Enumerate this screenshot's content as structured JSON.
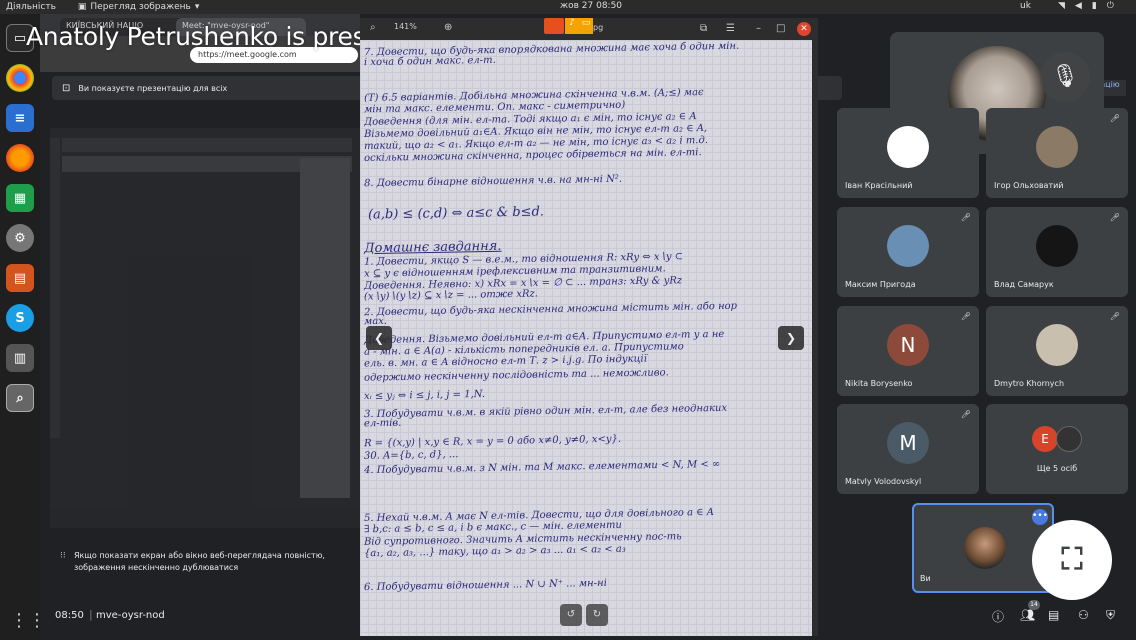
{
  "topbar": {
    "activities": "Діяльність",
    "app_name": "Перегляд зображень",
    "clock": "жов 27  08:50",
    "keyboard": "uk"
  },
  "browser": {
    "tab1": "КИЇВСЬКИЙ НАЦІО",
    "tab2": "Meet: \"mve-oysr-nod\"",
    "url": "https://meet.google.com"
  },
  "presenting_label": "Anatoly Petrushenko is presenting",
  "banner": {
    "text": "Ви показуєте презентацію для всіх",
    "right_text": "зацію"
  },
  "share_notice": "Якщо показати екран або вікно веб-переглядача повністю, зображення нескінченно дублюватися",
  "viewer": {
    "zoom": "141%",
    "file_suffix": "pg",
    "handwriting": [
      "7. Довести, що будь-яка впорядкована множина має хоча б один мін.",
      "і хоча б один макс. ел-т.",
      "(Т) 6.5 варіантів. Добільна множина скінченна ч.в.м. (A;≤) має",
      "мін та макс. елементи. Оп. макс - симетрично)",
      "Доведення (для мін. ел-та. Тоді якщо a₁ є мін, то існує a₂ ∈ A",
      "Візьмемо довільний a₁∈A. Якщо він не мін, то існує ел-т a₂ ∈ A,",
      "такий, що a₂ < a₁. Якщо ел-т a₂ — не мін, то існує a₃ < a₂ і т.д.",
      "оскільки множина скінченна, процес обірветься на мін. ел-ті.",
      "8. Довести бінарне відношення ч.в. на мн-ні N².",
      "(a,b) ≤ (c,d) ⇔ a≤c & b≤d.",
      "Домашнє завдання.",
      "1. Довести, якщо S — в.е.м., то відношення R: xRy ⇔ x∖y ⊂",
      "x ⊆ y є відношенням ірефлексивним та транзитивним.",
      "Доведення. Неявно: x) xRx = x∖x = ∅ ⊂ ... транз: xRy & yRz",
      "(x∖y)∖(y∖z) ⊆ x∖z = ... отже xRz.",
      "2. Довести, що будь-яка нескінченна множина містить мін. або нор",
      "мах.",
      "Доведення. Візьмемо довільний ел-т a∈A. Припустимо ел-т у а не",
      "а - мін. a ∈ A(a) - кількість попередників ел. а. Припустимо",
      "ель. в. мн. a ∈ A відносно ел-т Т. z > i.j.g. По індукції",
      "одержимо нескінченну послідовність та ... неможливо.",
      "xᵢ ≤ yⱼ ⇔ i ≤ j,  i, j = 1,N.",
      "3. Побудувати ч.в.м. в якій рівно один мін. ел-т, але без неоднаких",
      "ел-тів.",
      "R = {(x,y) | x,y ∈ R, x = y = 0 або x≠0, y≠0, x<y}.",
      "30. A={b, c, d}, ...",
      "4. Побудувати ч.в.м. з N мін. та M макс. елементами < N, M < ∞",
      "5. Нехай ч.в.м. A має N ел-тів. Довести, що для довільного a ∈ A",
      "∃ b,c: a ≤ b, c ≤ a, і b є макс., c — мін. елементи",
      "Від супротивного. Значить A містить нескінченну пос-ть",
      "{a₁, a₂, a₃, ...} таку, що a₁ > a₂ > a₃ ...   a₁ < a₂ < a₃",
      "6. Побудувати відношення ... N ∪ N⁺ ... мн-ні"
    ]
  },
  "participants": [
    {
      "name": "Іван Красільний",
      "initial": "",
      "color": "#ffffff",
      "muted": false
    },
    {
      "name": "Ігор Ольховатий",
      "initial": "",
      "color": "#8a7a66",
      "muted": true
    },
    {
      "name": "Максим Пригода",
      "initial": "",
      "color": "#6a8fb5",
      "muted": true
    },
    {
      "name": "Влад Самарук",
      "initial": "",
      "color": "#151515",
      "muted": true
    },
    {
      "name": "Nikita Borysenko",
      "initial": "N",
      "color": "#8d4a3a",
      "muted": true
    },
    {
      "name": "Dmytro Khornych",
      "initial": "",
      "color": "#c9bfae",
      "muted": true
    },
    {
      "name": "Matvly Volodovskyl",
      "initial": "M",
      "color": "#4a5a66",
      "muted": true
    }
  ],
  "others": {
    "count_label": "Ще 5 осіб",
    "initial": "E"
  },
  "me": {
    "label": "Ви"
  },
  "bottom": {
    "time": "08:50",
    "meeting_code": "mve-oysr-nod",
    "people_count": "14"
  }
}
